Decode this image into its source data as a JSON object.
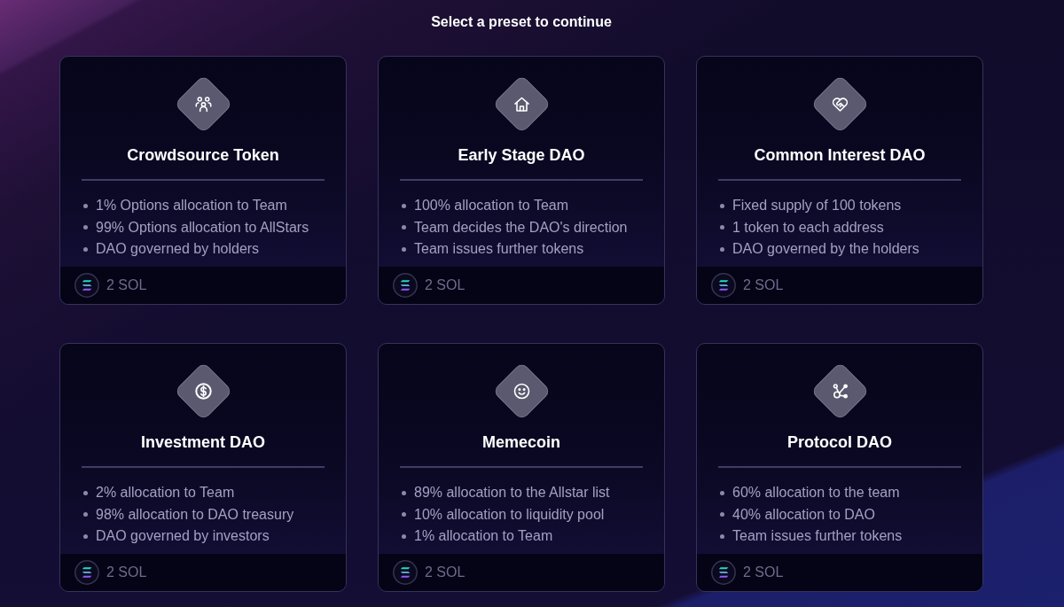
{
  "header": {
    "title": "Select a preset to continue"
  },
  "presets": [
    {
      "title": "Crowdsource Token",
      "features": [
        "1% Options allocation to Team",
        "99% Options allocation to AllStars",
        "DAO governed by holders"
      ],
      "price": "2 SOL"
    },
    {
      "title": "Early Stage DAO",
      "features": [
        "100% allocation to Team",
        "Team decides the DAO's direction",
        "Team issues further tokens"
      ],
      "price": "2 SOL"
    },
    {
      "title": "Common Interest DAO",
      "features": [
        "Fixed supply of 100 tokens",
        "1 token to each address",
        "DAO governed by the holders"
      ],
      "price": "2 SOL"
    },
    {
      "title": "Investment DAO",
      "features": [
        "2% allocation to Team",
        "98% allocation to DAO treasury",
        "DAO governed by investors"
      ],
      "price": "2 SOL"
    },
    {
      "title": "Memecoin",
      "features": [
        "89% allocation to the Allstar list",
        "10% allocation to liquidity pool",
        "1% allocation to Team"
      ],
      "price": "2 SOL"
    },
    {
      "title": "Protocol DAO",
      "features": [
        "60% allocation to the team",
        "40% allocation to DAO",
        "Team issues further tokens"
      ],
      "price": "2 SOL"
    }
  ]
}
